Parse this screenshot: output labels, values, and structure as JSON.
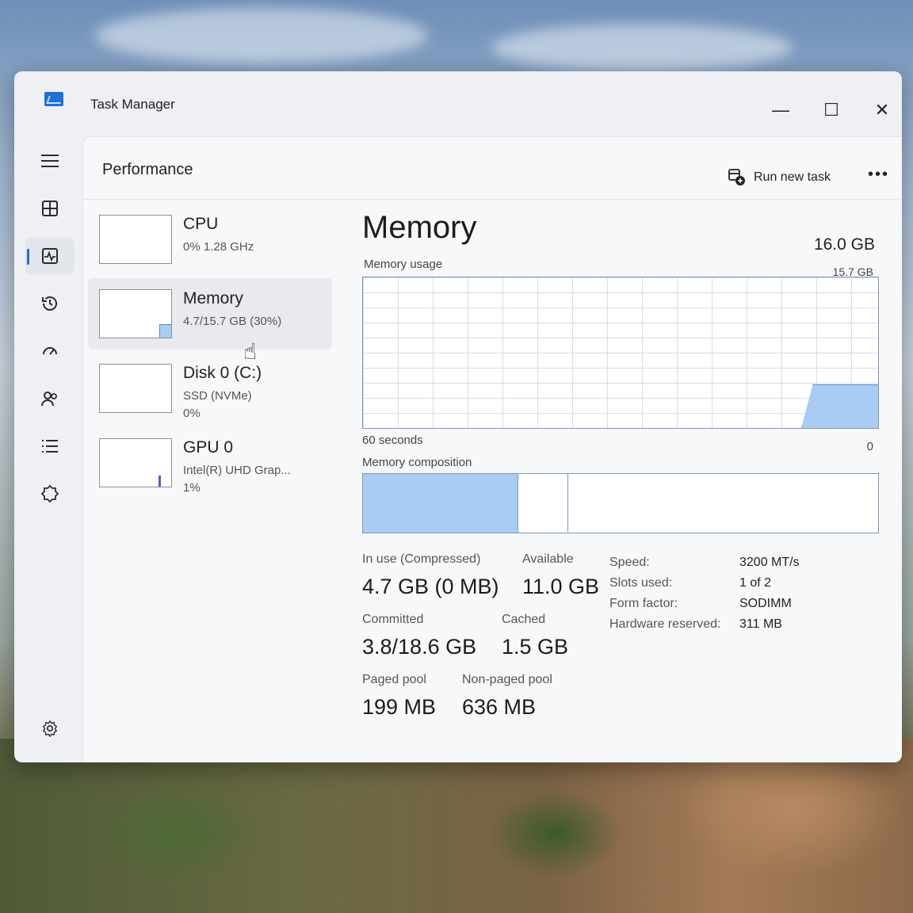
{
  "app": {
    "title": "Task Manager"
  },
  "window_controls": {
    "minimize": "—",
    "maximize": "☐",
    "close": "✕"
  },
  "nav": {
    "items": [
      {
        "name": "hamburger-icon"
      },
      {
        "name": "processes-icon"
      },
      {
        "name": "performance-icon",
        "active": true
      },
      {
        "name": "app-history-icon"
      },
      {
        "name": "startup-apps-icon"
      },
      {
        "name": "users-icon"
      },
      {
        "name": "details-icon"
      },
      {
        "name": "services-icon"
      }
    ],
    "settings": "settings-icon"
  },
  "header": {
    "title": "Performance",
    "run_new_task": "Run new task",
    "more": "•••"
  },
  "devices": [
    {
      "name": "CPU",
      "sub1": "0% 1.28 GHz",
      "sub2": ""
    },
    {
      "name": "Memory",
      "sub1": "4.7/15.7 GB (30%)",
      "sub2": "",
      "selected": true
    },
    {
      "name": "Disk 0 (C:)",
      "sub1": "SSD (NVMe)",
      "sub2": "0%"
    },
    {
      "name": "GPU 0",
      "sub1": "Intel(R) UHD Grap...",
      "sub2": "1%"
    }
  ],
  "memory": {
    "title": "Memory",
    "total": "16.0 GB",
    "usage_label": "Memory usage",
    "usage_max": "15.7 GB",
    "time_span": "60 seconds",
    "axis_min": "0",
    "composition_label": "Memory composition",
    "in_use_fraction": 0.3,
    "stats": {
      "in_use_label": "In use (Compressed)",
      "in_use_value": "4.7 GB (0 MB)",
      "available_label": "Available",
      "available_value": "11.0 GB",
      "committed_label": "Committed",
      "committed_value": "3.8/18.6 GB",
      "cached_label": "Cached",
      "cached_value": "1.5 GB",
      "paged_label": "Paged pool",
      "paged_value": "199 MB",
      "nonpaged_label": "Non-paged pool",
      "nonpaged_value": "636 MB"
    },
    "specs": [
      {
        "k": "Speed:",
        "v": "3200 MT/s"
      },
      {
        "k": "Slots used:",
        "v": "1 of 2"
      },
      {
        "k": "Form factor:",
        "v": "SODIMM"
      },
      {
        "k": "Hardware reserved:",
        "v": "311 MB"
      }
    ]
  },
  "colors": {
    "accent": "#1e6fd8",
    "memory_fill": "#a9ccf2",
    "memory_line": "#4f86c6"
  }
}
